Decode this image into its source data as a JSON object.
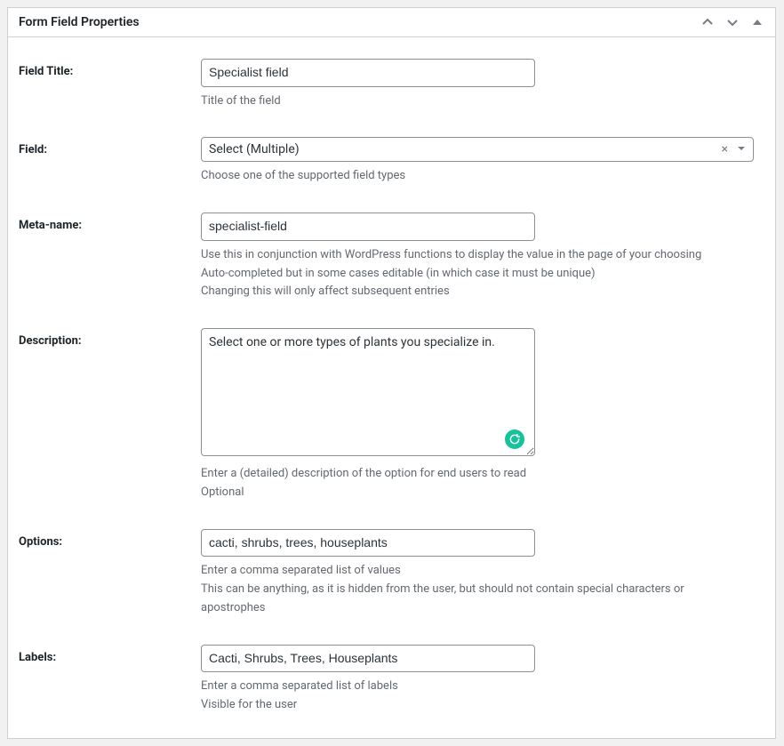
{
  "panel": {
    "title": "Form Field Properties"
  },
  "fields": {
    "fieldTitle": {
      "label": "Field Title:",
      "value": "Specialist field",
      "helper1": "Title of the field"
    },
    "fieldType": {
      "label": "Field:",
      "value": "Select (Multiple)",
      "helper1": "Choose one of the supported field types"
    },
    "metaName": {
      "label": "Meta-name:",
      "value": "specialist-field",
      "helper1": "Use this in conjunction with WordPress functions to display the value in the page of your choosing",
      "helper2": "Auto-completed but in some cases editable (in which case it must be unique)",
      "helper3": "Changing this will only affect subsequent entries"
    },
    "description": {
      "label": "Description:",
      "value": "Select one or more types of plants you specialize in.",
      "helper1": "Enter a (detailed) description of the option for end users to read",
      "helper2": "Optional"
    },
    "options": {
      "label": "Options:",
      "value": "cacti, shrubs, trees, houseplants",
      "helper1": "Enter a comma separated list of values",
      "helper2": "This can be anything, as it is hidden from the user, but should not contain special characters or apostrophes"
    },
    "labels": {
      "label": "Labels:",
      "value": "Cacti, Shrubs, Trees, Houseplants",
      "helper1": "Enter a comma separated list of labels",
      "helper2": "Visible for the user"
    }
  }
}
